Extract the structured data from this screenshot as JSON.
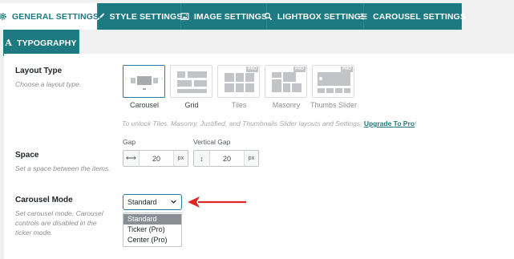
{
  "tabs": [
    {
      "label": "GENERAL SETTINGS",
      "icon": "gear-icon",
      "active": true
    },
    {
      "label": "STYLE SETTINGS",
      "icon": "brush-icon",
      "active": false
    },
    {
      "label": "IMAGE SETTINGS",
      "icon": "image-icon",
      "active": false
    },
    {
      "label": "LIGHTBOX SETTINGS",
      "icon": "search-icon",
      "active": false
    },
    {
      "label": "CAROUSEL SETTINGS",
      "icon": "sliders-icon",
      "active": false
    },
    {
      "label": "TYPOGRAPHY",
      "icon": "typography-icon",
      "active": false
    }
  ],
  "layout": {
    "label": "Layout Type",
    "description": "Choose a layout type.",
    "options": [
      {
        "label": "Carousel",
        "pro": false,
        "selected": true
      },
      {
        "label": "Grid",
        "pro": false,
        "selected": false
      },
      {
        "label": "Tiles",
        "pro": true,
        "selected": false
      },
      {
        "label": "Masonry",
        "pro": true,
        "selected": false
      },
      {
        "label": "Thumbs Slider",
        "pro": true,
        "selected": false
      }
    ],
    "pro_badge": "PRO",
    "unlock_text": "To unlock Tiles, Masonry, Justified, and Thumbnails Slider layouts and Settings,",
    "unlock_link": "Upgrade To Pro",
    "unlock_suffix": "!"
  },
  "space": {
    "label": "Space",
    "description": "Set a space between the items.",
    "gap": {
      "label": "Gap",
      "value": "20",
      "unit": "px"
    },
    "vertical_gap": {
      "label": "Vertical Gap",
      "value": "20",
      "unit": "px"
    }
  },
  "carousel_mode": {
    "label": "Carousel Mode",
    "description_lines": [
      "Set carousel mode. Carousel",
      "controls are disabled in the",
      "ticker mode."
    ],
    "selected": "Standard",
    "options": [
      {
        "label": "Standard",
        "highlighted": true
      },
      {
        "label": "Ticker (Pro)",
        "highlighted": false
      },
      {
        "label": "Center (Pro)",
        "highlighted": false
      }
    ]
  },
  "colors": {
    "tab_bg": "#1e7a81",
    "accent_blue": "#2a7ea6",
    "arrow_red": "#e02424"
  }
}
